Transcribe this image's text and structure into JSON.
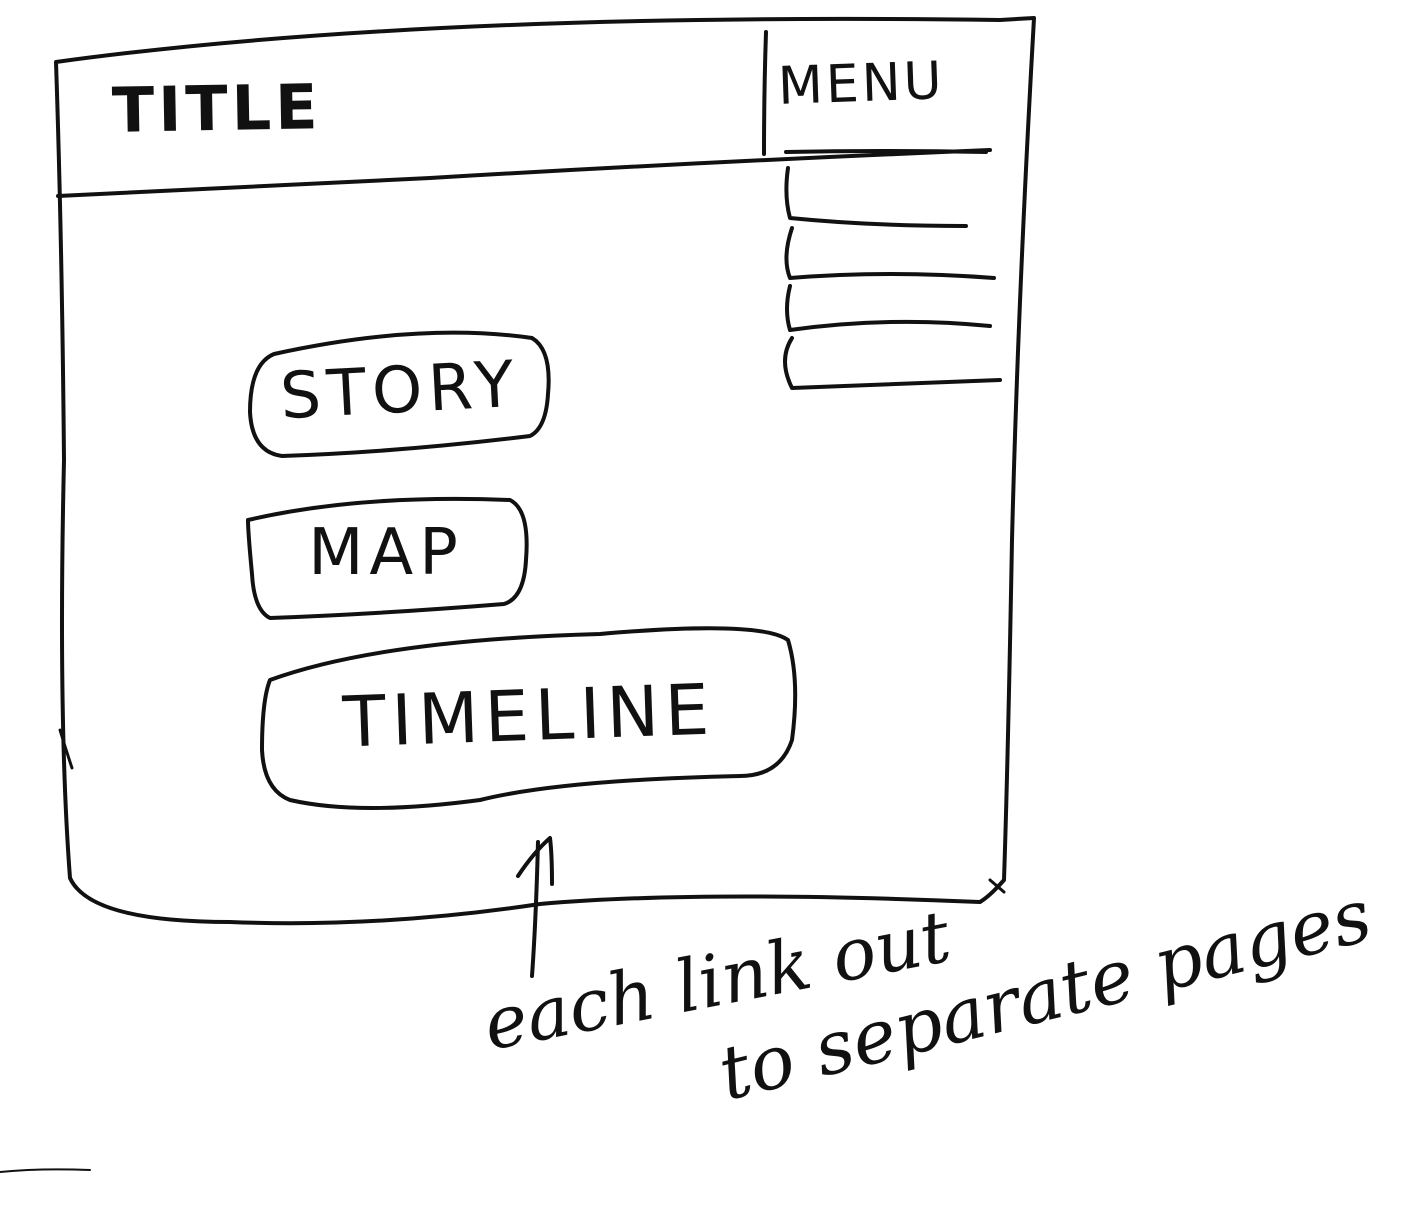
{
  "header": {
    "title": "TITLE",
    "menu_label": "MENU"
  },
  "menu": {
    "items": [
      {
        "label": ""
      },
      {
        "label": ""
      },
      {
        "label": ""
      },
      {
        "label": ""
      }
    ]
  },
  "main": {
    "buttons": [
      {
        "label": "STORY"
      },
      {
        "label": "MAP"
      },
      {
        "label": "TIMELINE"
      }
    ]
  },
  "annotation": {
    "line1": "each link out",
    "line2": "to separate pages"
  }
}
